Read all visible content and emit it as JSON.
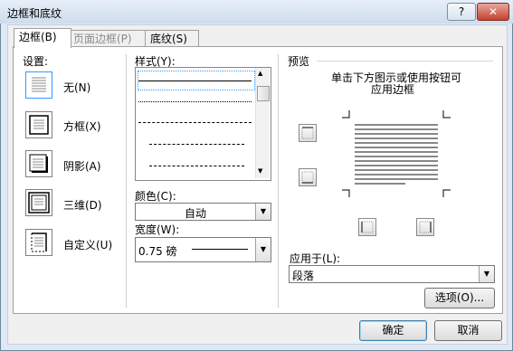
{
  "window": {
    "title": "边框和底纹",
    "help_glyph": "?",
    "close_glyph": "✕"
  },
  "tabs": [
    {
      "label": "边框(B)",
      "active": true
    },
    {
      "label": "页面边框(P)",
      "disabled": true
    },
    {
      "label": "底纹(S)"
    }
  ],
  "settings": {
    "label": "设置:",
    "items": [
      {
        "label": "无(N)",
        "icon": "setting-none-icon"
      },
      {
        "label": "方框(X)",
        "icon": "setting-box-icon"
      },
      {
        "label": "阴影(A)",
        "icon": "setting-shadow-icon"
      },
      {
        "label": "三维(D)",
        "icon": "setting-3d-icon"
      },
      {
        "label": "自定义(U)",
        "icon": "setting-custom-icon"
      }
    ]
  },
  "style": {
    "label": "样式(Y):",
    "options": [
      "solid",
      "dotted",
      "dashed-small",
      "dashed-medium",
      "dash-dot"
    ]
  },
  "color": {
    "label": "颜色(C):",
    "value": "自动"
  },
  "width": {
    "label": "宽度(W):",
    "value": "0.75 磅"
  },
  "preview": {
    "label": "预览",
    "hint_line1": "单击下方图示或使用按钮可",
    "hint_line2": "应用边框"
  },
  "apply_to": {
    "label": "应用于(L):",
    "value": "段落"
  },
  "buttons": {
    "options": "选项(O)...",
    "ok": "确定",
    "cancel": "取消"
  }
}
